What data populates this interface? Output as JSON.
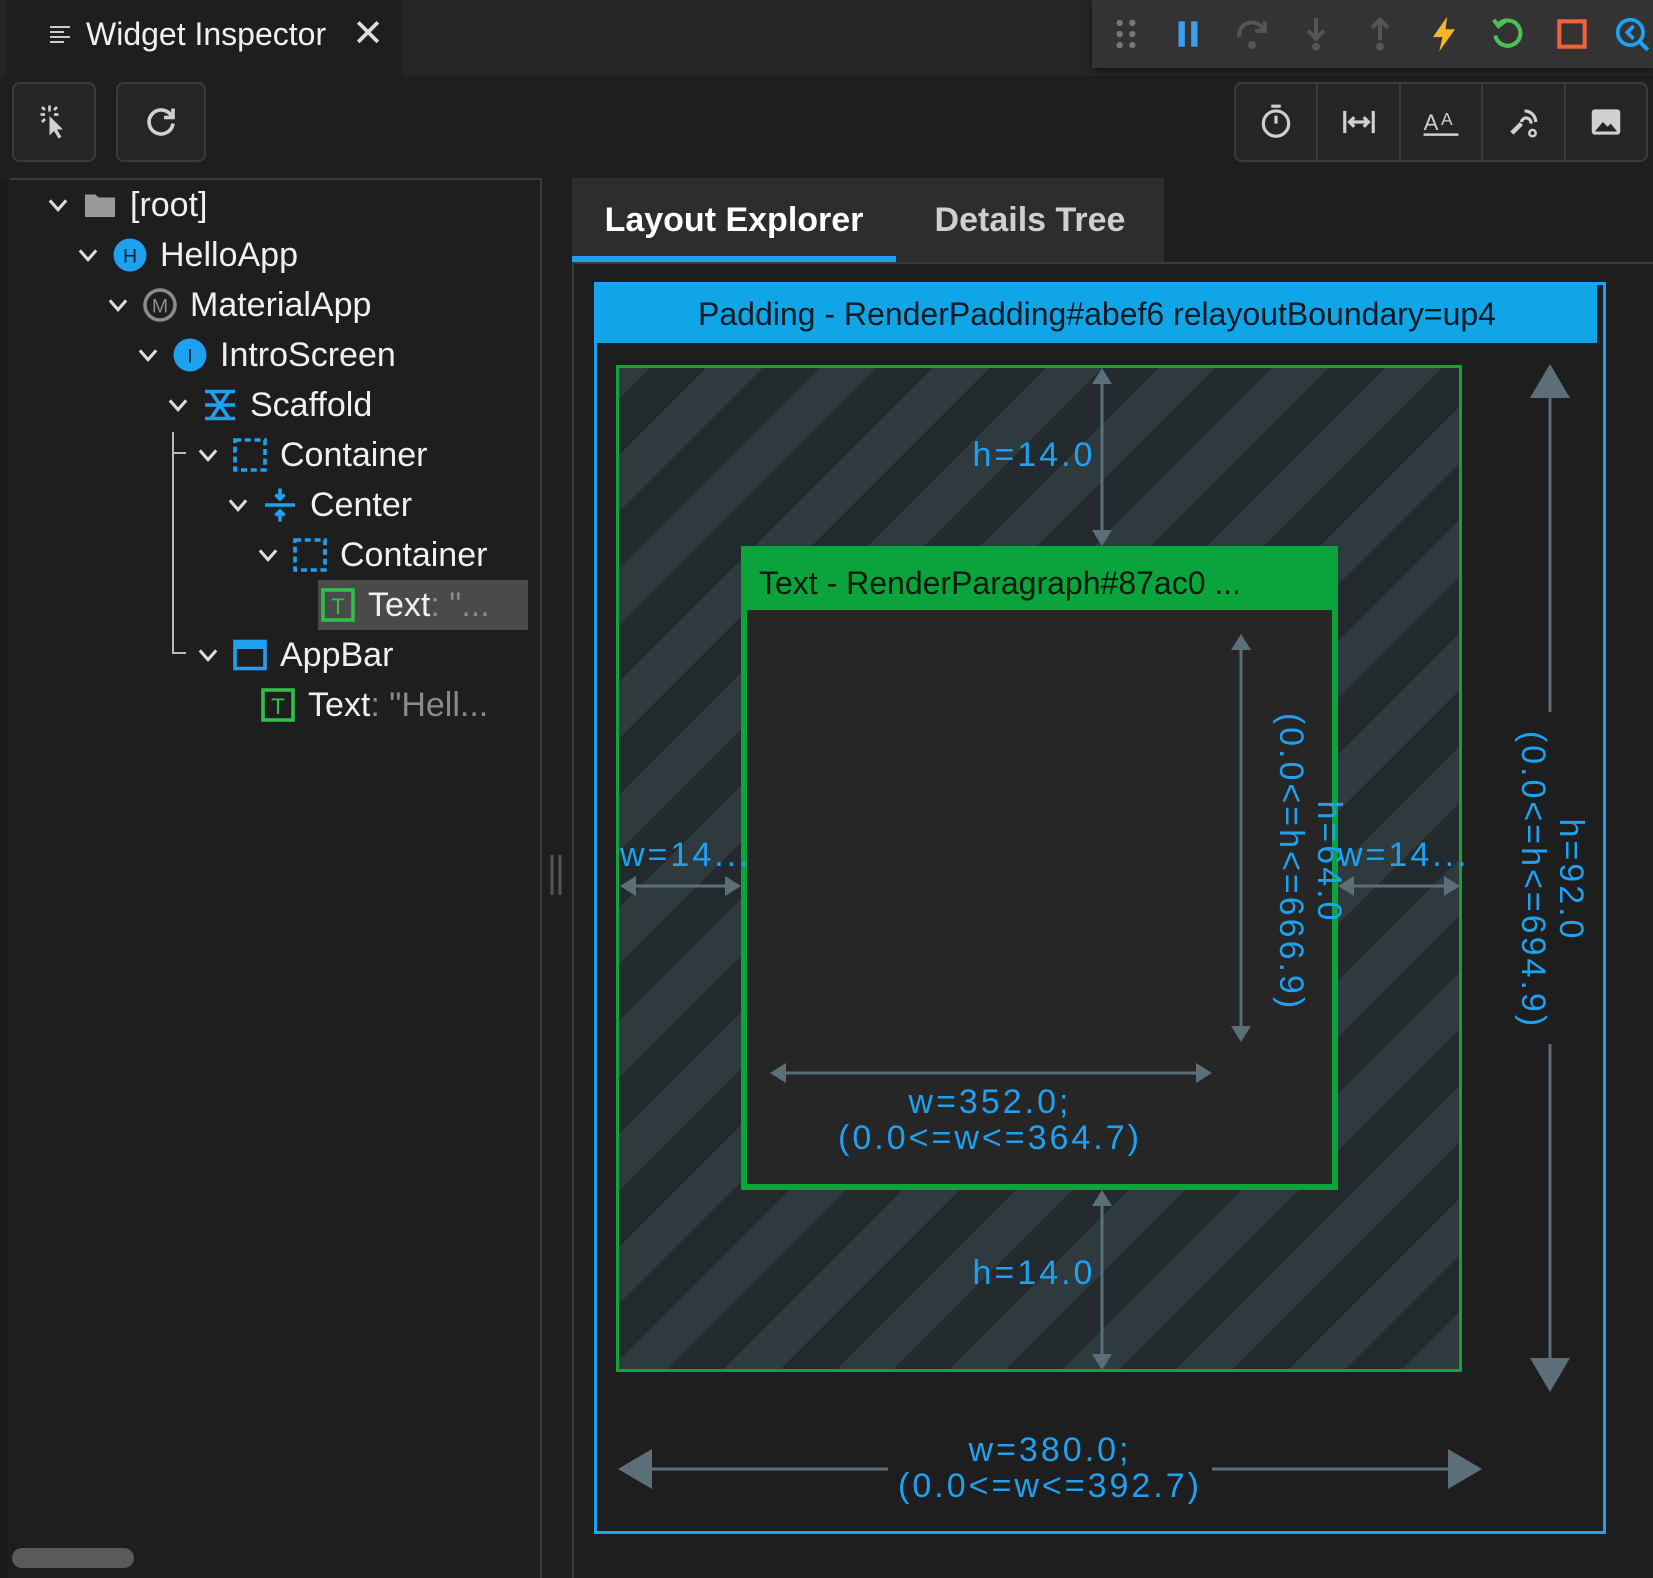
{
  "tab": {
    "title": "Widget Inspector",
    "close_symbol": "✕"
  },
  "tree": {
    "nodes": [
      {
        "label": "[root]",
        "suffix": "",
        "icon": "folder-icon"
      },
      {
        "label": "HelloApp",
        "suffix": "",
        "icon": "h-circle-icon",
        "badge": "H"
      },
      {
        "label": "MaterialApp",
        "suffix": "",
        "icon": "material-icon",
        "badge": "M"
      },
      {
        "label": "IntroScreen",
        "suffix": "",
        "icon": "i-circle-icon",
        "badge": "I"
      },
      {
        "label": "Scaffold",
        "suffix": "",
        "icon": "scaffold-icon"
      },
      {
        "label": "Container",
        "suffix": "",
        "icon": "container-icon"
      },
      {
        "label": "Center",
        "suffix": "",
        "icon": "center-icon"
      },
      {
        "label": "Container",
        "suffix": "",
        "icon": "container-icon"
      },
      {
        "label": "Text",
        "suffix": ": \"...",
        "icon": "text-icon",
        "badge": "T"
      },
      {
        "label": "AppBar",
        "suffix": "",
        "icon": "appbar-icon"
      },
      {
        "label": "Text",
        "suffix": ": \"Hell...",
        "icon": "text-icon",
        "badge": "T"
      }
    ]
  },
  "details_tabs": {
    "layout": "Layout Explorer",
    "details": "Details Tree"
  },
  "layout": {
    "padding_header": "Padding - RenderPadding#abef6 relayoutBoundary=up4",
    "text_header": "Text - RenderParagraph#87ac0 ...",
    "pad_top": "h=14.0",
    "pad_bottom": "h=14.0",
    "pad_left": "w=14...",
    "pad_right": "w=14...",
    "inner_height": "h=64.0",
    "inner_height_range": "(0.0<=h<=666.9)",
    "inner_width": "w=352.0;",
    "inner_width_range": "(0.0<=w<=364.7)",
    "outer_height": "h=92.0",
    "outer_height_range": "(0.0<=h<=694.9)",
    "outer_width": "w=380.0;",
    "outer_width_range": "(0.0<=w<=392.7)"
  },
  "colors": {
    "accent": "#1ea1f1",
    "green": "#0aa33c",
    "lightning": "#f7b52c",
    "restart": "#4fbf5a",
    "stop": "#f0643c"
  }
}
